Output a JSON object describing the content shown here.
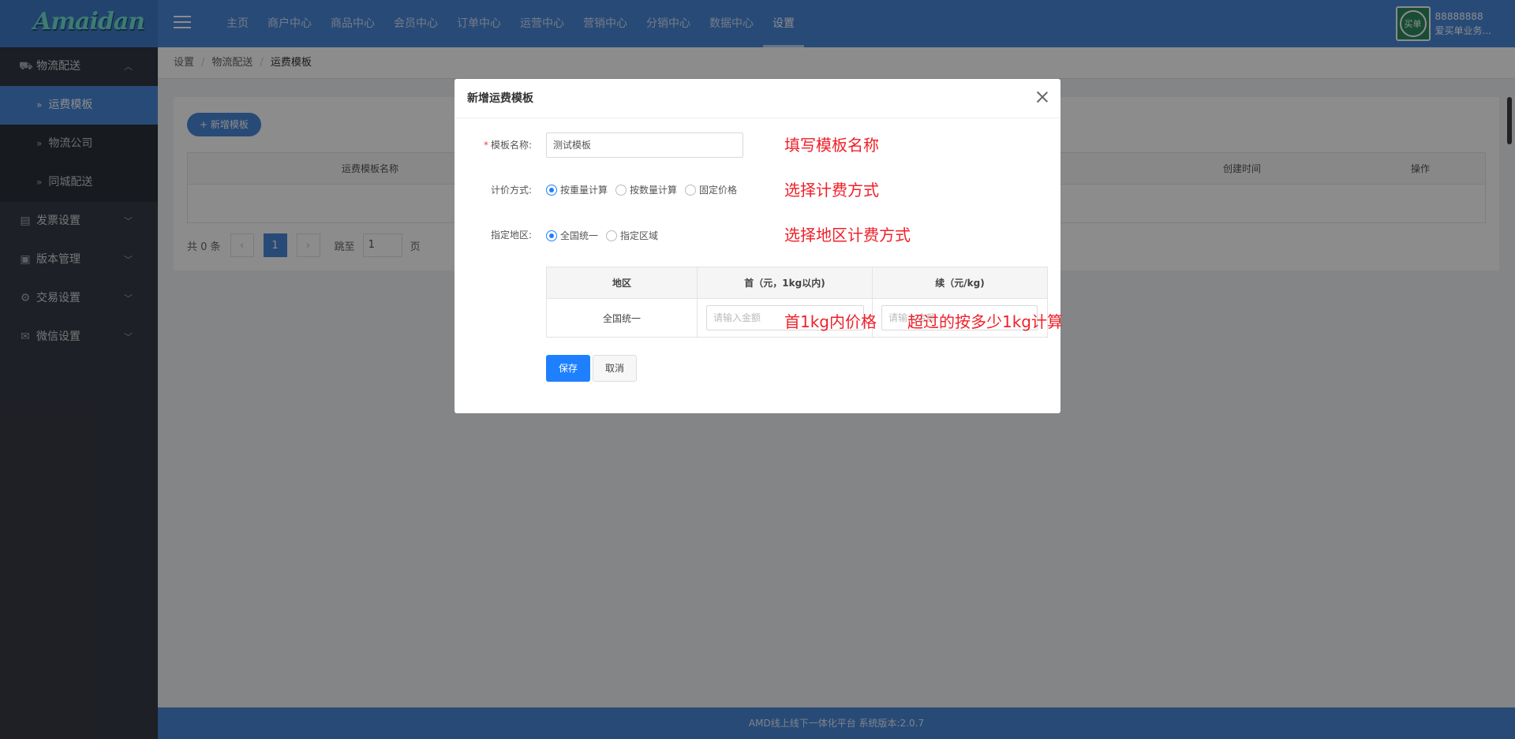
{
  "app": {
    "logo": "Amaidan"
  },
  "topnav": {
    "items": [
      "主页",
      "商户中心",
      "商品中心",
      "会员中心",
      "订单中心",
      "运营中心",
      "营销中心",
      "分销中心",
      "数据中心",
      "设置"
    ],
    "active_index": 9
  },
  "user": {
    "avatar_text": "买单",
    "id": "88888888",
    "name": "爱买单业务..."
  },
  "sidebar": {
    "group_logistics": "物流配送",
    "sub_items": [
      "运费模板",
      "物流公司",
      "同城配送"
    ],
    "active_sub": "运费模板",
    "groups": [
      "发票设置",
      "版本管理",
      "交易设置",
      "微信设置"
    ]
  },
  "breadcrumb": [
    "设置",
    "物流配送",
    "运费模板"
  ],
  "list": {
    "add_button": "+ 新增模板",
    "columns": [
      "运费模板名称",
      "创建时间",
      "操作"
    ]
  },
  "pager": {
    "total": "共 0 条",
    "current": "1",
    "jump_label": "跳至",
    "jump_value": "1",
    "page_unit": "页",
    "prev": "‹",
    "next": "›"
  },
  "footer": {
    "text": "AMD线上线下一体化平台 系统版本:2.0.7"
  },
  "modal": {
    "title": "新增运费模板",
    "name_label": "模板名称:",
    "name_required": "*",
    "name_value": "测试模板",
    "pricing_label": "计价方式:",
    "pricing_options": [
      "按重量计算",
      "按数量计算",
      "固定价格"
    ],
    "pricing_selected": "按重量计算",
    "region_label": "指定地区:",
    "region_options": [
      "全国统一",
      "指定区域"
    ],
    "region_selected": "全国统一",
    "table": {
      "headers": [
        "地区",
        "首（元，1kg以内)",
        "续（元/kg)"
      ],
      "row_region": "全国统一",
      "first_placeholder": "请输入金额",
      "next_placeholder": "请输入金额"
    },
    "save": "保存",
    "cancel": "取消"
  },
  "annotations": {
    "name": "填写模板名称",
    "pricing": "选择计费方式",
    "region": "选择地区计费方式",
    "first": "首1kg内价格",
    "next": "超过的按多少1kg计算"
  },
  "colors": {
    "primary": "#4a88d9",
    "modal_primary": "#1e80ff",
    "sidebar": "#363b45",
    "annotation": "#f0202a"
  }
}
